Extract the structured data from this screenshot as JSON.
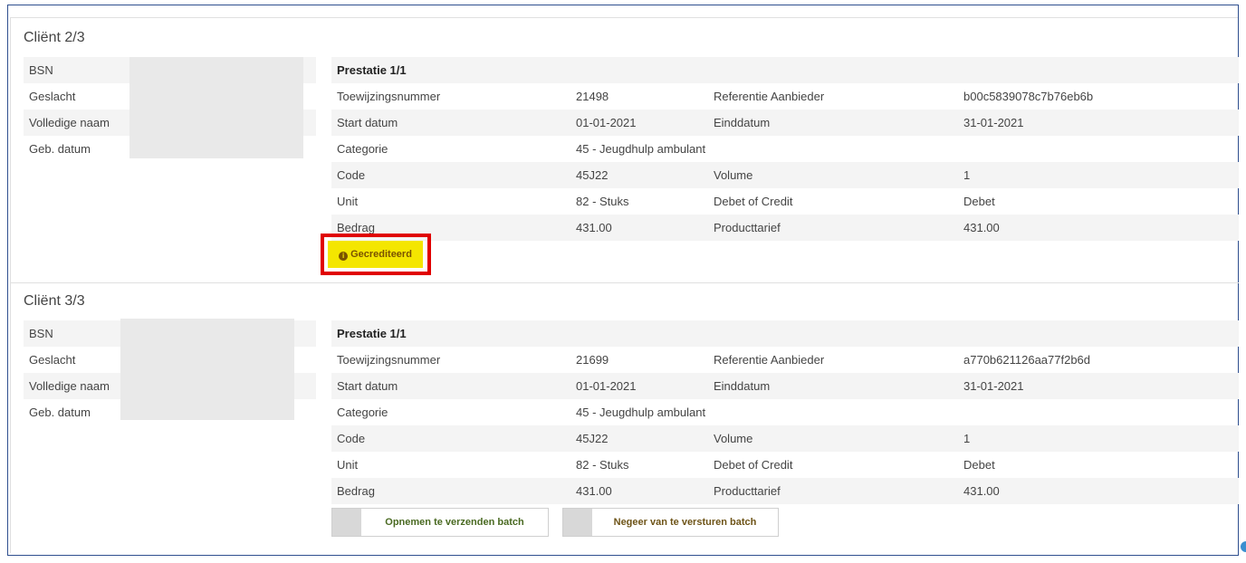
{
  "clients": [
    {
      "title": "Cliënt 2/3",
      "labels": [
        "BSN",
        "Geslacht",
        "Volledige naam",
        "Geb. datum"
      ],
      "prestatie": {
        "header": "Prestatie 1/1",
        "rows": [
          [
            "Toewijzingsnummer",
            "21498",
            "Referentie Aanbieder",
            "b00c5839078c7b76eb6b"
          ],
          [
            "Start datum",
            "01-01-2021",
            "Einddatum",
            "31-01-2021"
          ],
          [
            "Categorie",
            "45 - Jeugdhulp ambulant",
            "",
            ""
          ],
          [
            "Code",
            "45J22",
            "Volume",
            "1"
          ],
          [
            "Unit",
            "82 - Stuks",
            "Debet of Credit",
            "Debet"
          ],
          [
            "Bedrag",
            "431.00",
            "Producttarief",
            "431.00"
          ]
        ]
      },
      "status_badge": {
        "icon": "info-circle-icon",
        "label": "Gecrediteerd",
        "color": "#f4e600"
      }
    },
    {
      "title": "Cliënt 3/3",
      "labels": [
        "BSN",
        "Geslacht",
        "Volledige naam",
        "Geb. datum"
      ],
      "prestatie": {
        "header": "Prestatie 1/1",
        "rows": [
          [
            "Toewijzingsnummer",
            "21699",
            "Referentie Aanbieder",
            "a770b621126aa77f2b6d"
          ],
          [
            "Start datum",
            "01-01-2021",
            "Einddatum",
            "31-01-2021"
          ],
          [
            "Categorie",
            "45 - Jeugdhulp ambulant",
            "",
            ""
          ],
          [
            "Code",
            "45J22",
            "Volume",
            "1"
          ],
          [
            "Unit",
            "82 - Stuks",
            "Debet of Credit",
            "Debet"
          ],
          [
            "Bedrag",
            "431.00",
            "Producttarief",
            "431.00"
          ]
        ]
      },
      "actions": {
        "include_label": "Opnemen te verzenden batch",
        "ignore_label": "Negeer van te versturen batch"
      }
    }
  ],
  "colors": {
    "frame": "#2f4f8f",
    "highlight": "#e00000",
    "badge": "#f4e600"
  }
}
